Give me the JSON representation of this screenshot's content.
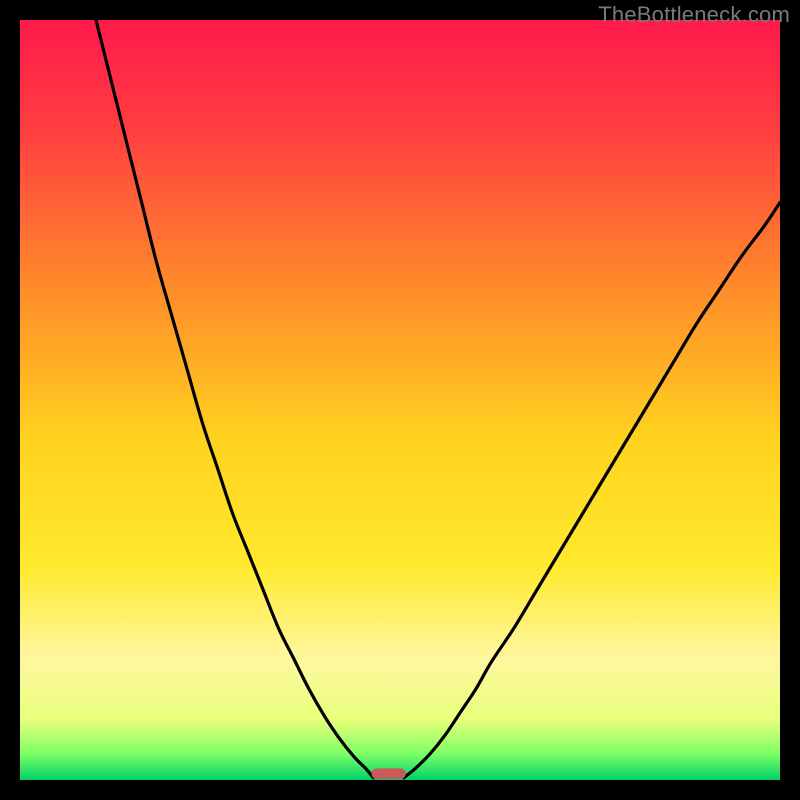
{
  "watermark": "TheBottleneck.com",
  "chart_data": {
    "type": "line",
    "title": "",
    "xlabel": "",
    "ylabel": "",
    "xlim": [
      0,
      100
    ],
    "ylim": [
      0,
      100
    ],
    "gradient_stops": [
      {
        "offset": 0.0,
        "color": "#ff1a4b"
      },
      {
        "offset": 0.15,
        "color": "#ff4040"
      },
      {
        "offset": 0.35,
        "color": "#ff8a2a"
      },
      {
        "offset": 0.55,
        "color": "#ffd21f"
      },
      {
        "offset": 0.72,
        "color": "#ffe92f"
      },
      {
        "offset": 0.84,
        "color": "#fff7a0"
      },
      {
        "offset": 0.92,
        "color": "#e9ff7a"
      },
      {
        "offset": 0.965,
        "color": "#7fff66"
      },
      {
        "offset": 1.0,
        "color": "#00d268"
      }
    ],
    "series": [
      {
        "name": "left-curve",
        "x": [
          10,
          12,
          14,
          16,
          18,
          20,
          22,
          24,
          26,
          28,
          30,
          32,
          34,
          36,
          38,
          40,
          42,
          44,
          45.5,
          46.5
        ],
        "values": [
          100,
          92,
          84,
          76,
          68,
          61,
          54,
          47,
          41,
          35,
          30,
          25,
          20,
          16,
          12,
          8.5,
          5.5,
          3,
          1.5,
          0.3
        ]
      },
      {
        "name": "right-curve",
        "x": [
          50.5,
          52,
          54,
          56,
          58,
          60,
          62,
          65,
          68,
          71,
          74,
          77,
          80,
          83,
          86,
          89,
          92,
          95,
          98,
          100
        ],
        "values": [
          0.3,
          1.5,
          3.5,
          6,
          9,
          12,
          15.5,
          20,
          25,
          30,
          35,
          40,
          45,
          50,
          55,
          60,
          64.5,
          69,
          73,
          76
        ]
      }
    ],
    "marker": {
      "x_center": 48.5,
      "width": 4.5,
      "height_pct": 1.4,
      "color": "#c85a5a",
      "corner_radius": 5
    }
  }
}
